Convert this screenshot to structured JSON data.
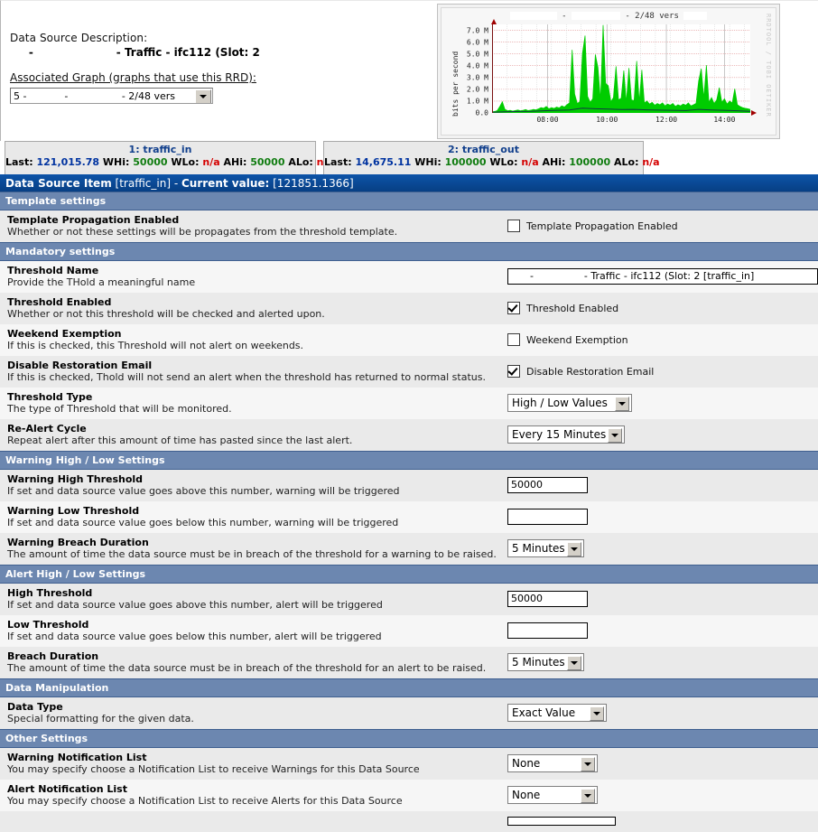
{
  "header": {
    "ds_description_label": "Data Source Description:",
    "ds_description_value": "     -                      - Traffic - ifc112 (Slot: 2",
    "associated_graph_label": "Associated Graph (graphs that use this RRD):",
    "associated_graph_value": "5 -            -                 - 2/48 vers"
  },
  "graph": {
    "title_suffix": "- 2/48 vers",
    "title_sep": "-",
    "watermark": "RRDTOOL / TOBI OETIKER",
    "ylabel": "bits per second"
  },
  "chart_data": {
    "type": "area",
    "title": "- 2/48 vers",
    "xlabel": "",
    "ylabel": "bits per second",
    "ylim": [
      0,
      7500000
    ],
    "yticks": [
      "0.0",
      "1.0 M",
      "2.0 M",
      "3.0 M",
      "4.0 M",
      "5.0 M",
      "6.0 M",
      "7.0 M"
    ],
    "ytick_values": [
      0,
      1000000,
      2000000,
      3000000,
      4000000,
      5000000,
      6000000,
      7000000
    ],
    "xticks": [
      "08:00",
      "10:00",
      "12:00",
      "14:00"
    ],
    "xtick_positions": [
      0.215,
      0.445,
      0.675,
      0.9
    ],
    "grid": true,
    "legend": "none",
    "series": [
      {
        "name": "traffic_in",
        "color": "#00cc00",
        "style": "area",
        "x": [
          0,
          0.01,
          0.02,
          0.03,
          0.04,
          0.05,
          0.06,
          0.07,
          0.08,
          0.09,
          0.1,
          0.11,
          0.12,
          0.13,
          0.14,
          0.15,
          0.16,
          0.17,
          0.18,
          0.19,
          0.2,
          0.21,
          0.22,
          0.23,
          0.24,
          0.25,
          0.26,
          0.27,
          0.28,
          0.29,
          0.3,
          0.31,
          0.32,
          0.33,
          0.34,
          0.35,
          0.36,
          0.37,
          0.38,
          0.39,
          0.4,
          0.41,
          0.42,
          0.43,
          0.44,
          0.45,
          0.46,
          0.47,
          0.48,
          0.49,
          0.5,
          0.51,
          0.52,
          0.53,
          0.54,
          0.55,
          0.56,
          0.57,
          0.58,
          0.59,
          0.6,
          0.61,
          0.62,
          0.63,
          0.64,
          0.65,
          0.66,
          0.67,
          0.68,
          0.69,
          0.7,
          0.71,
          0.72,
          0.73,
          0.74,
          0.75,
          0.76,
          0.77,
          0.78,
          0.79,
          0.8,
          0.81,
          0.82,
          0.83,
          0.84,
          0.85,
          0.86,
          0.87,
          0.88,
          0.89,
          0.9,
          0.91,
          0.92,
          0.93,
          0.94,
          0.95,
          0.96,
          0.97,
          0.98,
          0.99,
          1.0
        ],
        "y": [
          0.1,
          0.12,
          0.2,
          0.55,
          0.95,
          0.3,
          0.18,
          0.22,
          0.15,
          0.2,
          0.25,
          0.18,
          0.22,
          0.28,
          0.2,
          0.24,
          0.3,
          0.26,
          0.35,
          0.45,
          0.4,
          0.55,
          0.35,
          0.45,
          0.38,
          0.5,
          0.42,
          0.6,
          0.5,
          0.7,
          0.85,
          5.35,
          1.6,
          0.8,
          0.95,
          5.05,
          6.55,
          1.4,
          0.9,
          1.2,
          4.95,
          3.85,
          1.1,
          7.45,
          2.5,
          2.3,
          0.95,
          1.3,
          3.95,
          1.1,
          1.25,
          3.6,
          0.9,
          3.8,
          1.1,
          1.05,
          4.4,
          0.95,
          3.65,
          0.85,
          1.0,
          0.75,
          0.9,
          0.65,
          0.8,
          0.7,
          0.85,
          0.6,
          0.75,
          0.65,
          0.8,
          0.55,
          0.7,
          0.6,
          0.75,
          0.65,
          0.85,
          0.6,
          0.7,
          0.8,
          2.7,
          3.75,
          1.25,
          4.05,
          0.9,
          1.3,
          0.8,
          1.1,
          2.15,
          0.9,
          1.2,
          0.75,
          1.0,
          0.85,
          2.05,
          0.7,
          0.55,
          0.45,
          0.4,
          0.35,
          0.3
        ]
      },
      {
        "name": "traffic_out",
        "color": "#113344",
        "style": "line",
        "x": [
          0,
          0.05,
          0.1,
          0.15,
          0.2,
          0.25,
          0.3,
          0.35,
          0.4,
          0.45,
          0.5,
          0.55,
          0.6,
          0.65,
          0.7,
          0.75,
          0.8,
          0.85,
          0.9,
          0.95,
          1.0
        ],
        "y": [
          0.05,
          0.1,
          0.12,
          0.14,
          0.18,
          0.22,
          0.25,
          0.4,
          0.35,
          0.32,
          0.28,
          0.3,
          0.26,
          0.24,
          0.22,
          0.2,
          0.3,
          0.25,
          0.22,
          0.18,
          0.14
        ]
      }
    ],
    "y_unit_scale": 1000000
  },
  "tabs": [
    {
      "title": "1: traffic_in",
      "last_label": "Last:",
      "last_value": "121,015.78",
      "whi_label": "WHi:",
      "whi_value": "50000",
      "wlo_label": "WLo:",
      "wlo_value": "n/a",
      "ahi_label": "AHi:",
      "ahi_value": "50000",
      "alo_label": "ALo:",
      "alo_value": "n/a"
    },
    {
      "title": "2: traffic_out",
      "last_label": "Last:",
      "last_value": "14,675.11",
      "whi_label": "WHi:",
      "whi_value": "100000",
      "wlo_label": "WLo:",
      "wlo_value": "n/a",
      "ahi_label": "AHi:",
      "ahi_value": "100000",
      "alo_label": "ALo:",
      "alo_value": "n/a"
    }
  ],
  "title_bar": {
    "prefix": "Data Source Item",
    "item": "[traffic_in] -",
    "current_label": "Current value:",
    "current_value": "[121851.1366]"
  },
  "sections": {
    "template": "Template settings",
    "mandatory": "Mandatory settings",
    "warning": "Warning High / Low Settings",
    "alert": "Alert High / Low Settings",
    "manipulation": "Data Manipulation",
    "other": "Other Settings"
  },
  "fields": {
    "template_propagation": {
      "title": "Template Propagation Enabled",
      "desc": "Whether or not these settings will be propagates from the threshold template.",
      "checkbox_label": "Template Propagation Enabled",
      "checked": false
    },
    "threshold_name": {
      "title": "Threshold Name",
      "desc": "Provide the THold a meaningful name",
      "value": "      -                - Traffic - ifc112 (Slot: 2 [traffic_in]"
    },
    "threshold_enabled": {
      "title": "Threshold Enabled",
      "desc": "Whether or not this threshold will be checked and alerted upon.",
      "checkbox_label": "Threshold Enabled",
      "checked": true
    },
    "weekend_exemption": {
      "title": "Weekend Exemption",
      "desc": "If this is checked, this Threshold will not alert on weekends.",
      "checkbox_label": "Weekend Exemption",
      "checked": false
    },
    "disable_restoration_email": {
      "title": "Disable Restoration Email",
      "desc": "If this is checked, Thold will not send an alert when the threshold has returned to normal status.",
      "checkbox_label": "Disable Restoration Email",
      "checked": true
    },
    "threshold_type": {
      "title": "Threshold Type",
      "desc": "The type of Threshold that will be monitored.",
      "value": "High / Low Values"
    },
    "realert_cycle": {
      "title": "Re-Alert Cycle",
      "desc": "Repeat alert after this amount of time has pasted since the last alert.",
      "value": "Every 15 Minutes"
    },
    "warning_high_threshold": {
      "title": "Warning High Threshold",
      "desc": "If set and data source value goes above this number, warning will be triggered",
      "value": "50000"
    },
    "warning_low_threshold": {
      "title": "Warning Low Threshold",
      "desc": "If set and data source value goes below this number, warning will be triggered",
      "value": ""
    },
    "warning_breach_duration": {
      "title": "Warning Breach Duration",
      "desc": "The amount of time the data source must be in breach of the threshold for a warning to be raised.",
      "value": "5 Minutes"
    },
    "high_threshold": {
      "title": "High Threshold",
      "desc": "If set and data source value goes above this number, alert will be triggered",
      "value": "50000"
    },
    "low_threshold": {
      "title": "Low Threshold",
      "desc": "If set and data source value goes below this number, alert will be triggered",
      "value": ""
    },
    "breach_duration": {
      "title": "Breach Duration",
      "desc": "The amount of time the data source must be in breach of the threshold for an alert to be raised.",
      "value": "5 Minutes"
    },
    "data_type": {
      "title": "Data Type",
      "desc": "Special formatting for the given data.",
      "value": "Exact Value"
    },
    "warning_notification_list": {
      "title": "Warning Notification List",
      "desc": "You may specify choose a Notification List to receive Warnings for this Data Source",
      "value": "None"
    },
    "alert_notification_list": {
      "title": "Alert Notification List",
      "desc": "You may specify choose a Notification List to receive Alerts for this Data Source",
      "value": "None"
    }
  }
}
